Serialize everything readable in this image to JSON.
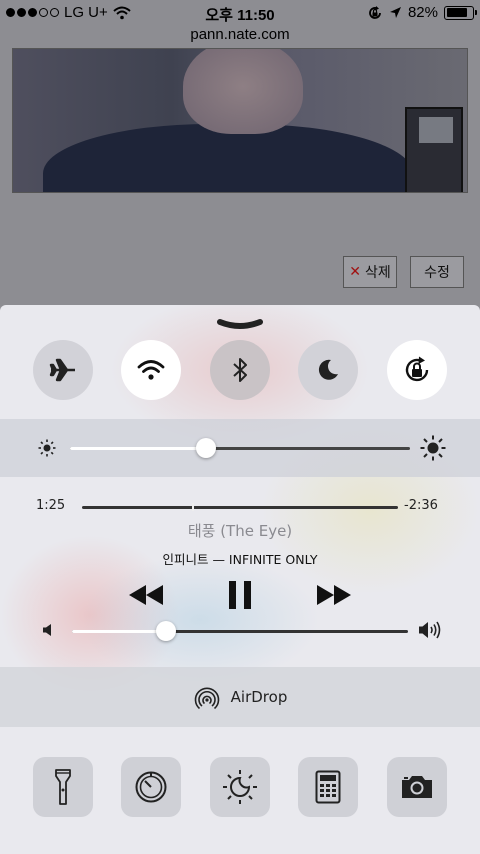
{
  "status_bar": {
    "carrier": "LG U+",
    "time": "오후 11:50",
    "battery": "82%",
    "battery_level": 0.82,
    "signal_bars_filled": 3,
    "signal_bars_total": 5
  },
  "browser": {
    "url": "pann.nate.com"
  },
  "webpage": {
    "delete_button": "삭제",
    "edit_button": "수정"
  },
  "control_center": {
    "toggles": [
      {
        "name": "airplane-mode",
        "icon": "airplane-icon",
        "on": false
      },
      {
        "name": "wifi",
        "icon": "wifi-icon",
        "on": true
      },
      {
        "name": "bluetooth",
        "icon": "bluetooth-icon",
        "on": false
      },
      {
        "name": "do-not-disturb",
        "icon": "moon-icon",
        "on": false
      },
      {
        "name": "rotation-lock",
        "icon": "rotation-lock-icon",
        "on": true
      }
    ],
    "brightness_level": 0.4,
    "now_playing": {
      "elapsed": "1:25",
      "remaining": "-2:36",
      "progress": 0.35,
      "title": "태풍 (The Eye)",
      "artist_album": "인피니트 — INFINITE ONLY",
      "volume": 0.28
    },
    "airdrop_label": "AirDrop",
    "shortcuts": [
      "flashlight-icon",
      "timer-icon",
      "night-shift-icon",
      "calculator-icon",
      "camera-icon"
    ]
  }
}
